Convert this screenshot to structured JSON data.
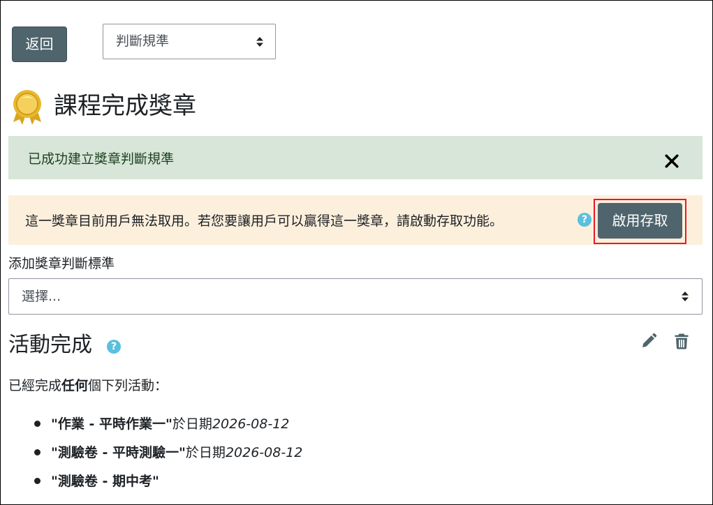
{
  "toolbar": {
    "back_label": "返回",
    "criteria_select_value": "判斷規準"
  },
  "page": {
    "title": "課程完成獎章",
    "badge_icon": "gold-badge-icon"
  },
  "alerts": {
    "success_message": "已成功建立獎章判斷規準",
    "close_symbol": "×",
    "warning_message": "這一獎章目前用戶無法取用。若您要讓用戶可以贏得這一獎章，請啟動存取功能。",
    "help_symbol": "?",
    "enable_access_label": "啟用存取",
    "highlight_color": "#e8182a"
  },
  "add_criteria": {
    "label": "添加獎章判斷標準",
    "select_value": "選擇..."
  },
  "activity_section": {
    "title": "活動完成",
    "help_symbol": "?",
    "desc_prefix": "已經完成",
    "desc_bold": "任何",
    "desc_suffix": "個下列活動：",
    "items": [
      {
        "name": "\"作業 - 平時作業一\"",
        "date_prefix": "於日期",
        "date": "2026-08-12"
      },
      {
        "name": "\"測驗卷 - 平時測驗一\"",
        "date_prefix": "於日期",
        "date": "2026-08-12"
      },
      {
        "name": "\"測驗卷 - 期中考\"",
        "date_prefix": "",
        "date": ""
      }
    ]
  },
  "colors": {
    "button_bg": "#4f646c",
    "success_bg": "#d7e6d8",
    "warning_bg": "#fcefdc",
    "help_icon": "#5bc0de"
  }
}
